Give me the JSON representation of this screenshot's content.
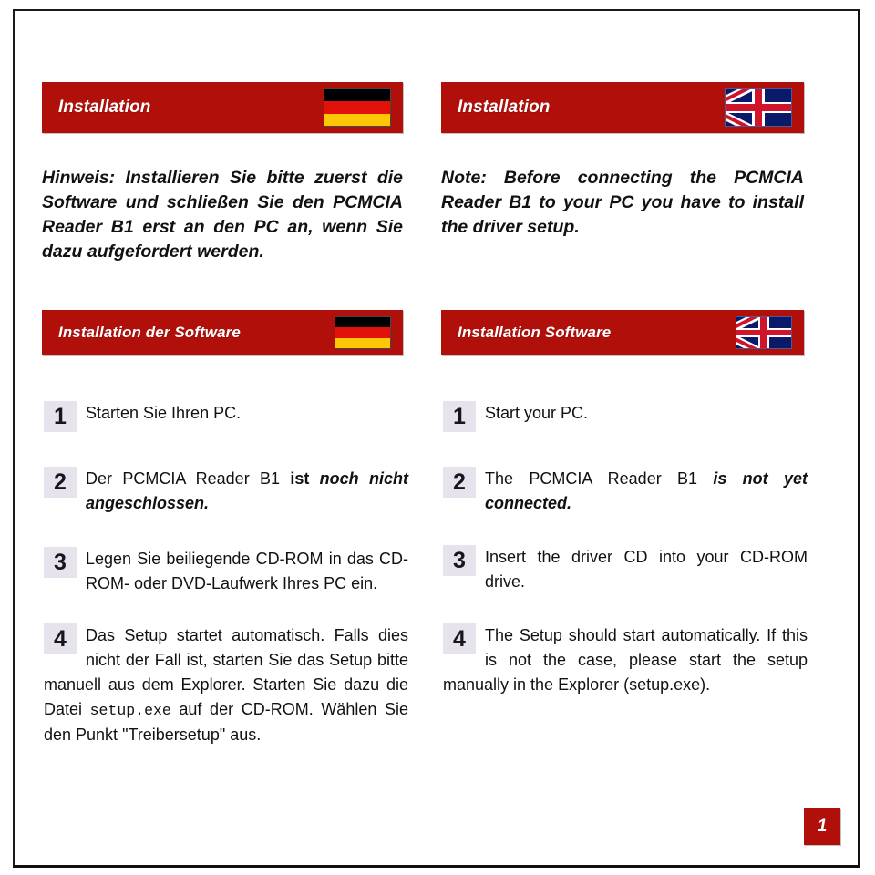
{
  "page": {
    "number": "1",
    "accent_color": "#b10f09",
    "badge_color": "#e6e3ec"
  },
  "columns": {
    "german": {
      "header": {
        "title": "Installation",
        "flag": "german-flag-icon"
      },
      "note": "Hinweis: Installieren Sie bitte zuerst die Software und schließen Sie den PCMCIA Reader B1 erst an den PC an, wenn Sie dazu aufgefordert werden.",
      "section_header": {
        "title": "Installation der Software",
        "flag": "german-flag-icon"
      },
      "steps": [
        {
          "num": "1",
          "text": "Starten Sie Ihren PC."
        },
        {
          "num": "2",
          "text_a": "Der PCMCIA Reader B1 ",
          "text_b": "ist ",
          "text_c": "noch nicht angeschlossen."
        },
        {
          "num": "3",
          "text": "Legen Sie beiliegende CD-ROM in das CD-ROM- oder DVD-Laufwerk Ihres PC ein."
        },
        {
          "num": "4",
          "text_a": "Das Setup startet automatisch. Falls dies nicht der Fall ist, starten Sie das Setup bitte manuell aus dem Explorer. Starten Sie dazu die Datei ",
          "text_mono": "setup.exe",
          "text_b": " auf der CD-ROM. Wählen Sie den Punkt \"Treibersetup\" aus."
        }
      ]
    },
    "english": {
      "header": {
        "title": "Installation",
        "flag": "uk-flag-icon"
      },
      "note": "Note: Before connecting the PCMCIA Reader B1  to your PC you have to install the driver setup.",
      "section_header": {
        "title": "Installation Software",
        "flag": "uk-flag-icon"
      },
      "steps": [
        {
          "num": "1",
          "text": "Start your PC."
        },
        {
          "num": "2",
          "text_a": "The PCMCIA Reader B1 ",
          "text_b": "",
          "text_c": "is not yet connected."
        },
        {
          "num": "3",
          "text": "Insert the driver CD into your CD-ROM drive."
        },
        {
          "num": "4",
          "text_a": "The Setup should start automatically. If this is not the case, please start the setup manually in the Explorer (setup.exe).",
          "text_mono": "",
          "text_b": ""
        }
      ]
    }
  }
}
